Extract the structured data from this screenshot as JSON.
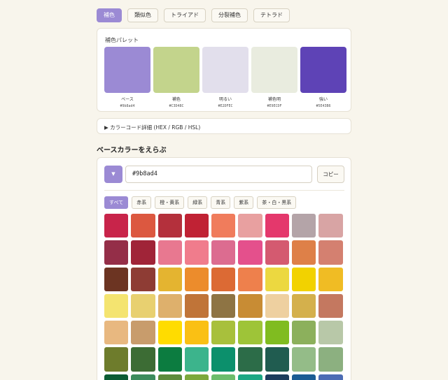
{
  "tabs": [
    "補色",
    "類似色",
    "トライアド",
    "分裂補色",
    "テトラド"
  ],
  "active_tab": 0,
  "palette": {
    "title": "補色パレット",
    "swatches": [
      {
        "label": "ベース",
        "hex": "#9b8ad4",
        "color": "#9b8ad4"
      },
      {
        "label": "補色",
        "hex": "#C3D48C",
        "color": "#c3d48c"
      },
      {
        "label": "明るい",
        "hex": "#E2DFEC",
        "color": "#e2dfec"
      },
      {
        "label": "補色明",
        "hex": "#E9ECDF",
        "color": "#e9ecdf"
      },
      {
        "label": "強い",
        "hex": "#5E43B6",
        "color": "#5e43b6"
      }
    ]
  },
  "details": {
    "label": "▶ カラーコード詳細 (HEX / RGB / HSL)"
  },
  "picker": {
    "section_title": "ベースカラーをえらぶ",
    "dropdown_glyph": "▼",
    "hex_value": "#9b8ad4",
    "copy_label": "コピー",
    "filters": [
      "すべて",
      "赤系",
      "橙・黄系",
      "緑系",
      "青系",
      "紫系",
      "茶・白・黒系"
    ],
    "active_filter": 0,
    "colors": [
      "#c8244a",
      "#dc5840",
      "#b4303c",
      "#c02234",
      "#f07c5c",
      "#e8a0a0",
      "#e4386c",
      "#b4a4a8",
      "#d8a4a4",
      "#942e48",
      "#a02438",
      "#e87890",
      "#f07c8c",
      "#dc6c90",
      "#e4508c",
      "#d45a70",
      "#de8048",
      "#d48070",
      "#6c3422",
      "#8e3c34",
      "#e4b430",
      "#ec8c2c",
      "#dc6a34",
      "#ee804c",
      "#ecd840",
      "#f2d200",
      "#f0bc24",
      "#f4e470",
      "#e8d070",
      "#deb06c",
      "#c07438",
      "#8e7444",
      "#c88c34",
      "#eed0a0",
      "#d4b04c",
      "#c47860",
      "#e8b880",
      "#c89c6c",
      "#ffdc00",
      "#fac014",
      "#a8c03c",
      "#9ec438",
      "#80bc20",
      "#8cb05c",
      "#b8c8a8",
      "#6e7c2c",
      "#3c6c34",
      "#0c7c40",
      "#3cb48c",
      "#0c906c",
      "#2c6c48",
      "#205c50",
      "#94bc88",
      "#8cb080",
      "#0c5c34",
      "#3c8c5c",
      "#5c8c3c",
      "#7ca83c",
      "#6cbc6c",
      "#1ca884",
      "#1c3c5c",
      "#1c5c94",
      "#4c6cb4"
    ]
  }
}
